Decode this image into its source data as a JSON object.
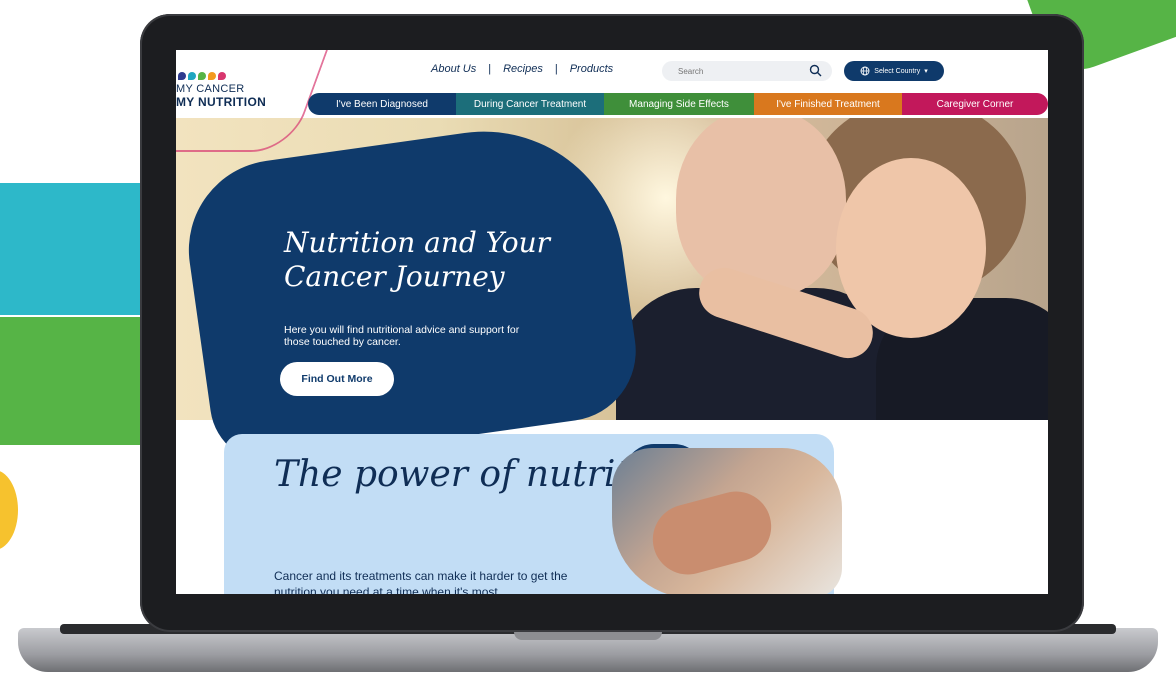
{
  "brand": {
    "logo_line1": "MY CANCER",
    "logo_line2": "MY NUTRITION",
    "logo_dot_colors": [
      "#2e3b8f",
      "#1fa6c0",
      "#56b446",
      "#f39a1e",
      "#d8366e"
    ]
  },
  "top_links": [
    {
      "label": "About Us"
    },
    {
      "label": "Recipes"
    },
    {
      "label": "Products"
    }
  ],
  "search": {
    "placeholder": "Search"
  },
  "country_selector": {
    "label": "Select Country"
  },
  "nav_tabs": [
    {
      "label": "I've Been Diagnosed",
      "color": "#0f3a6b"
    },
    {
      "label": "During Cancer Treatment",
      "color": "#1c6e7a"
    },
    {
      "label": "Managing Side Effects",
      "color": "#3f8f3a"
    },
    {
      "label": "I've Finished Treatment",
      "color": "#d9781e"
    },
    {
      "label": "Caregiver Corner",
      "color": "#c2185b"
    }
  ],
  "hero": {
    "title": "Nutrition and Your Cancer Journey",
    "subtitle": "Here you will find nutritional advice and support for those touched by cancer.",
    "cta_label": "Find Out More"
  },
  "power_section": {
    "title": "The power of nutrition",
    "text": "Cancer and its treatments can make it harder to get the nutrition you need at a time when it's most"
  },
  "colors": {
    "navy": "#0f3a6b",
    "card_blue": "#c2ddf5",
    "teal_deco": "#2db8c9",
    "green_deco": "#56b446",
    "yellow_deco": "#f6c22e"
  }
}
